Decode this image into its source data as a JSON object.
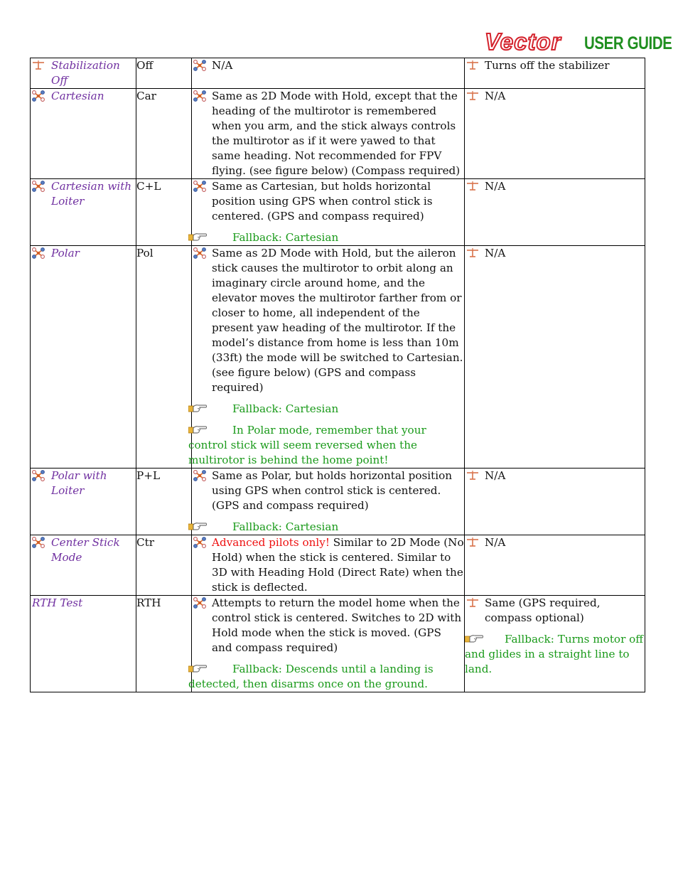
{
  "header": {
    "logo_text": "Vector",
    "title": "USER GUIDE"
  },
  "icons": {
    "airplane": "airplane-icon",
    "multirotor": "quadcopter-icon",
    "note": "pointing-hand-icon"
  },
  "colors": {
    "mode_name": "#7030a0",
    "fallback": "#1a9a1a",
    "warning": "#ee1111",
    "logo": "#d4232d",
    "title": "#1f8f1f"
  },
  "rows": [
    {
      "name": "Stabilization Off",
      "name_icon": "airplane",
      "abbr": "Off",
      "multirotor": {
        "text": "N/A",
        "fallbacks": []
      },
      "airplane": {
        "text": "Turns off the stabilizer",
        "fallbacks": []
      }
    },
    {
      "name": "Cartesian",
      "name_icon": "multirotor",
      "abbr": "Car",
      "multirotor": {
        "text": "Same as 2D Mode with Hold, except that the heading of the multirotor is remembered when you arm, and the stick always controls the multirotor as if it were yawed to that same heading.  Not recommended for FPV flying. (see figure below) (Compass required)",
        "fallbacks": []
      },
      "airplane": {
        "text": "N/A",
        "fallbacks": []
      }
    },
    {
      "name": "Cartesian with Loiter",
      "name_icon": "multirotor",
      "abbr": "C+L",
      "multirotor": {
        "text": "Same as Cartesian, but holds horizontal position using GPS when control stick is centered. (GPS and compass required)",
        "fallbacks": [
          "Fallback: Cartesian"
        ]
      },
      "airplane": {
        "text": "N/A",
        "fallbacks": []
      }
    },
    {
      "name": "Polar",
      "name_icon": "multirotor",
      "abbr": "Pol",
      "multirotor": {
        "text": "Same as 2D Mode with Hold, but the aileron stick causes the multirotor to orbit along an imaginary circle around home, and the elevator moves the multirotor farther from or closer to home, all independent of the present yaw heading of the multirotor. If the model’s distance from home is less than 10m (33ft) the mode will be switched to Cartesian. (see figure below) (GPS and compass required)",
        "fallbacks": [
          "Fallback: Cartesian",
          "In Polar mode, remember that your control stick will seem reversed when the multirotor is behind the home point!"
        ]
      },
      "airplane": {
        "text": "N/A",
        "fallbacks": []
      }
    },
    {
      "name": "Polar with Loiter",
      "name_icon": "multirotor",
      "abbr": "P+L",
      "multirotor": {
        "text": "Same as Polar, but holds horizontal position using GPS when control stick is centered. (GPS and compass required)",
        "fallbacks": [
          "Fallback: Cartesian"
        ]
      },
      "airplane": {
        "text": "N/A",
        "fallbacks": []
      }
    },
    {
      "name": "Center Stick Mode",
      "name_icon": "multirotor",
      "abbr": "Ctr",
      "multirotor": {
        "warning": "Advanced pilots only!",
        "text": " Similar to 2D Mode (No Hold) when the stick is centered.  Similar to 3D with Heading Hold (Direct Rate) when the stick is deflected.",
        "fallbacks": []
      },
      "airplane": {
        "text": "N/A",
        "fallbacks": []
      }
    },
    {
      "name": "RTH Test",
      "name_icon": null,
      "abbr": "RTH",
      "multirotor": {
        "text": "Attempts to return the model home when the control stick is centered. Switches to 2D with Hold mode when the stick is moved. (GPS and compass required)",
        "fallbacks": [
          "Fallback: Descends until a landing is detected, then disarms once on the ground."
        ]
      },
      "airplane": {
        "text": "Same (GPS required, compass optional)",
        "fallbacks": [
          "Fallback: Turns motor off and glides in a straight line to land."
        ]
      }
    }
  ]
}
